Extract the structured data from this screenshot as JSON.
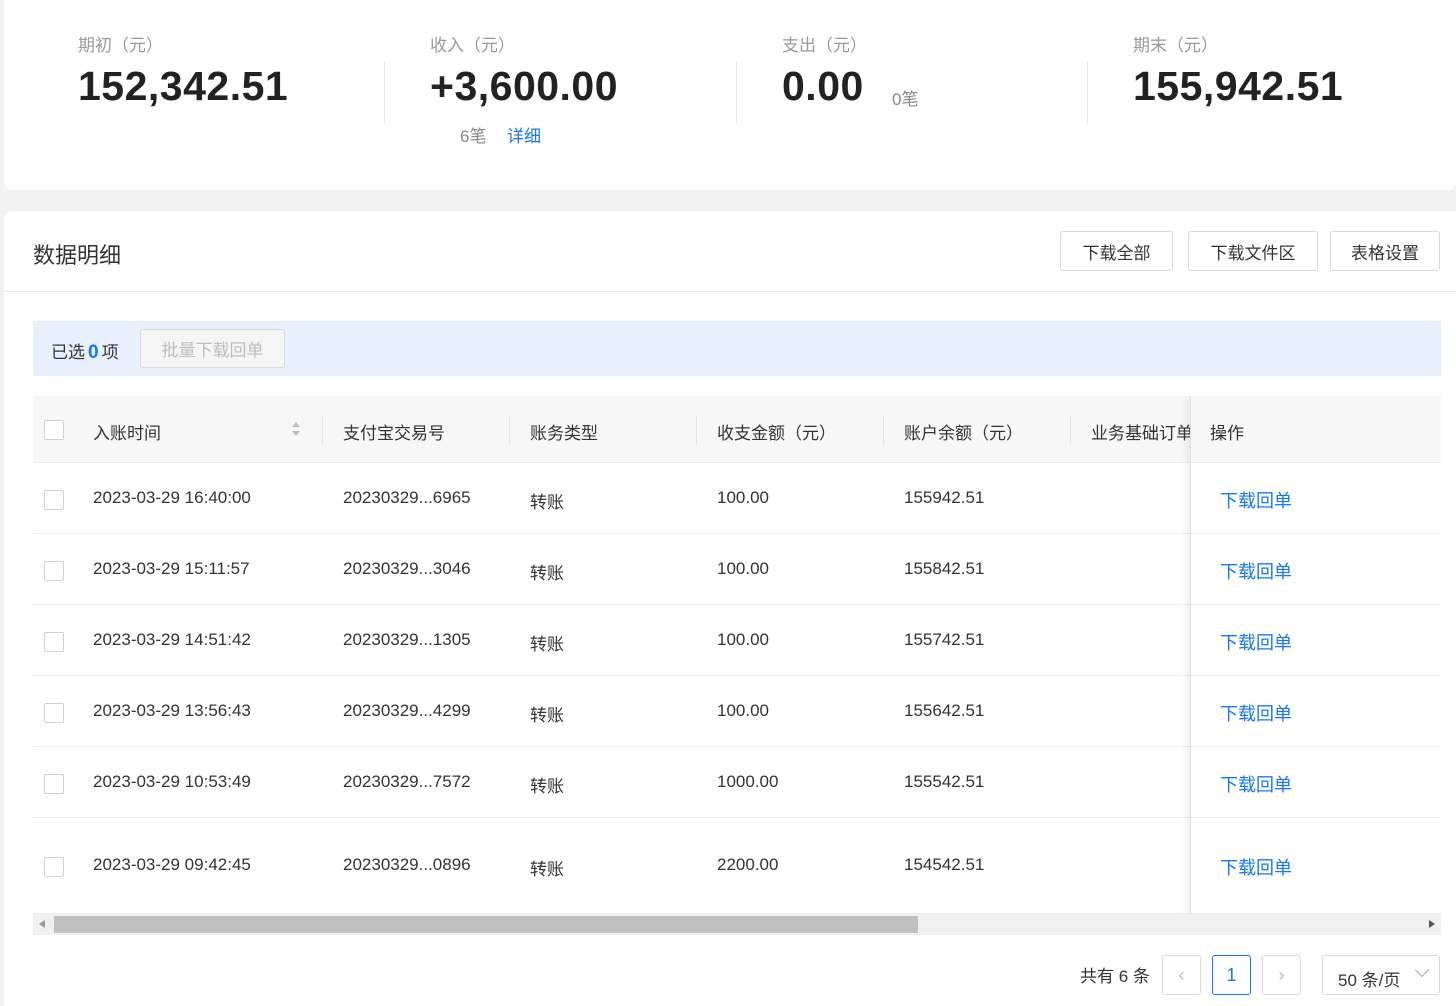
{
  "summary": {
    "opening": {
      "label": "期初（元）",
      "value": "152,342.51"
    },
    "income": {
      "label": "收入（元）",
      "value": "+3,600.00",
      "count": "6笔",
      "detail_link": "详细"
    },
    "expense": {
      "label": "支出（元）",
      "value": "0.00",
      "count": "0笔"
    },
    "closing": {
      "label": "期末（元）",
      "value": "155,942.51"
    }
  },
  "detail": {
    "title": "数据明细",
    "buttons": {
      "download_all": "下载全部",
      "download_files": "下载文件区",
      "table_settings": "表格设置"
    }
  },
  "selection": {
    "prefix": "已选",
    "count": "0",
    "suffix": "项",
    "batch_button": "批量下载回单"
  },
  "table": {
    "columns": {
      "time": "入账时间",
      "trade_no": "支付宝交易号",
      "type": "账务类型",
      "amount": "收支金额（元）",
      "balance": "账户余额（元）",
      "order": "业务基础订单",
      "ops": "操作"
    },
    "rows": [
      {
        "time": "2023-03-29 16:40:00",
        "trade_no": "20230329...6965",
        "type": "转账",
        "amount": "100.00",
        "balance": "155942.51",
        "action": "下载回单"
      },
      {
        "time": "2023-03-29 15:11:57",
        "trade_no": "20230329...3046",
        "type": "转账",
        "amount": "100.00",
        "balance": "155842.51",
        "action": "下载回单"
      },
      {
        "time": "2023-03-29 14:51:42",
        "trade_no": "20230329...1305",
        "type": "转账",
        "amount": "100.00",
        "balance": "155742.51",
        "action": "下载回单"
      },
      {
        "time": "2023-03-29 13:56:43",
        "trade_no": "20230329...4299",
        "type": "转账",
        "amount": "100.00",
        "balance": "155642.51",
        "action": "下载回单"
      },
      {
        "time": "2023-03-29 10:53:49",
        "trade_no": "20230329...7572",
        "type": "转账",
        "amount": "1000.00",
        "balance": "155542.51",
        "action": "下载回单"
      },
      {
        "time": "2023-03-29 09:42:45",
        "trade_no": "20230329...0896",
        "type": "转账",
        "amount": "2200.00",
        "balance": "154542.51",
        "action": "下载回单"
      }
    ]
  },
  "pagination": {
    "total": "共有 6 条",
    "prev": "‹",
    "current": "1",
    "next": "›",
    "page_size": "50 条/页"
  },
  "colors": {
    "accent": "#1677ff",
    "selection_bar": "#e8f0fd",
    "header_bg": "#f7f7f7"
  }
}
